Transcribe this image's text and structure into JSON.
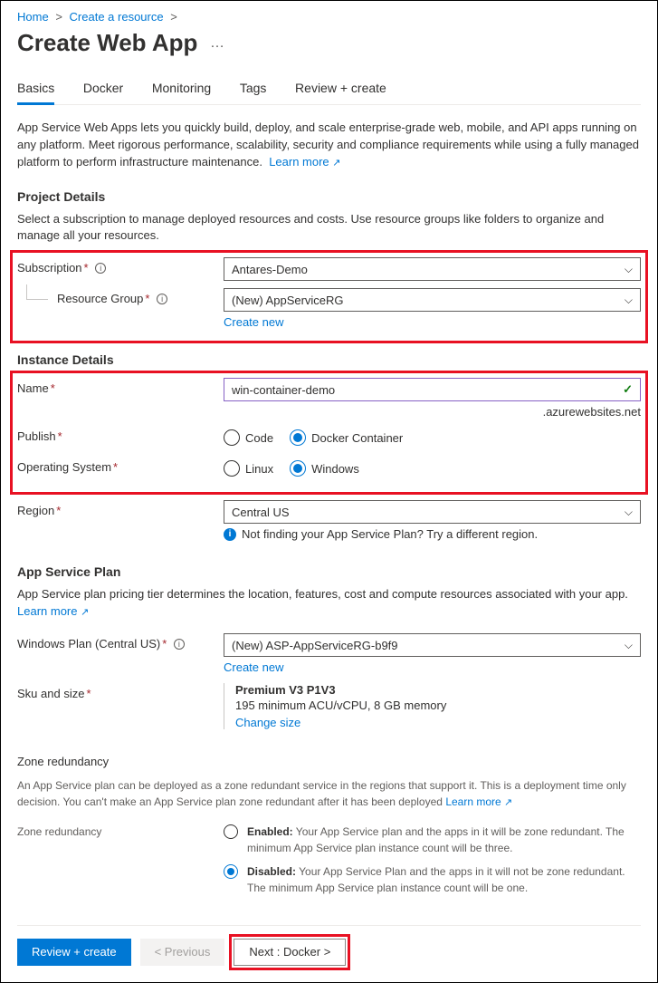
{
  "breadcrumb": {
    "home": "Home",
    "create_resource": "Create a resource"
  },
  "page_title": "Create Web App",
  "tabs": {
    "basics": "Basics",
    "docker": "Docker",
    "monitoring": "Monitoring",
    "tags": "Tags",
    "review": "Review + create"
  },
  "intro": "App Service Web Apps lets you quickly build, deploy, and scale enterprise-grade web, mobile, and API apps running on any platform. Meet rigorous performance, scalability, security and compliance requirements while using a fully managed platform to perform infrastructure maintenance.",
  "learn_more": "Learn more",
  "project_details": {
    "heading": "Project Details",
    "caption": "Select a subscription to manage deployed resources and costs. Use resource groups like folders to organize and manage all your resources.",
    "subscription_label": "Subscription",
    "subscription_value": "Antares-Demo",
    "rg_label": "Resource Group",
    "rg_value": "(New) AppServiceRG",
    "create_new": "Create new"
  },
  "instance_details": {
    "heading": "Instance Details",
    "name_label": "Name",
    "name_value": "win-container-demo",
    "url_suffix": ".azurewebsites.net",
    "publish_label": "Publish",
    "publish_code": "Code",
    "publish_docker": "Docker Container",
    "os_label": "Operating System",
    "os_linux": "Linux",
    "os_windows": "Windows",
    "region_label": "Region",
    "region_value": "Central US",
    "region_hint": "Not finding your App Service Plan? Try a different region."
  },
  "app_service_plan": {
    "heading": "App Service Plan",
    "caption": "App Service plan pricing tier determines the location, features, cost and compute resources associated with your app.",
    "plan_label": "Windows Plan (Central US)",
    "plan_value": "(New) ASP-AppServiceRG-b9f9",
    "create_new": "Create new",
    "sku_label": "Sku and size",
    "sku_title": "Premium V3 P1V3",
    "sku_desc": "195 minimum ACU/vCPU, 8 GB memory",
    "change_size": "Change size"
  },
  "zone": {
    "heading": "Zone redundancy",
    "caption": "An App Service plan can be deployed as a zone redundant service in the regions that support it. This is a deployment time only decision. You can't make an App Service plan zone redundant after it has been deployed",
    "label": "Zone redundancy",
    "enabled_title": "Enabled:",
    "enabled_desc": "Your App Service plan and the apps in it will be zone redundant. The minimum App Service plan instance count will be three.",
    "disabled_title": "Disabled:",
    "disabled_desc": "Your App Service Plan and the apps in it will not be zone redundant. The minimum App Service plan instance count will be one."
  },
  "footer": {
    "review": "Review + create",
    "previous": "< Previous",
    "next": "Next : Docker >"
  }
}
